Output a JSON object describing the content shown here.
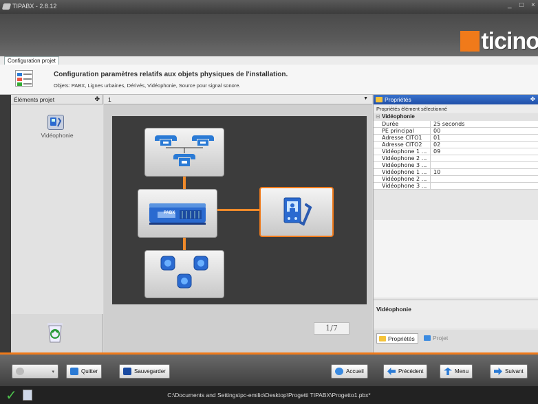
{
  "window": {
    "title": "TIPABX - 2.8.12",
    "minimize": "_",
    "maximize": "□",
    "close": "×"
  },
  "brand": {
    "logo_first": "b",
    "logo_rest": "ticino",
    "accent": "#f07a1a"
  },
  "tab": {
    "label": "Configuration projet"
  },
  "description": {
    "title": "Configuration paramètres relatifs aux objets physiques de l'installation.",
    "subtitle": "Objets: PABX, Lignes urbaines, Dérivés, Vidéophonie, Source pour signal sonore."
  },
  "left_panel": {
    "header": "Éléments projet",
    "pin": "ᵖ",
    "item_label": "Vidéophonie"
  },
  "center": {
    "selector_value": "1",
    "pabx_label": "PABX",
    "page_indicator": "1/7"
  },
  "properties": {
    "header": "Propriétés",
    "subheader": "Propriétés élément sélectionné",
    "category": "Vidéophonie",
    "collapse": "⊟",
    "rows": [
      {
        "key": "Durée",
        "value": "25 seconds"
      },
      {
        "key": "PE principal",
        "value": "00"
      },
      {
        "key": "Adresse CITO1",
        "value": "01"
      },
      {
        "key": "Adresse CITO2",
        "value": "02"
      },
      {
        "key": "Vidéophone 1 ...",
        "value": "09"
      },
      {
        "key": "Vidéophone 2 ...",
        "value": ""
      },
      {
        "key": "Vidéophone 3 ...",
        "value": ""
      },
      {
        "key": "Vidéophone 1 ...",
        "value": "10"
      },
      {
        "key": "Vidéophone 2 ...",
        "value": ""
      },
      {
        "key": "Vidéophone 3 ...",
        "value": ""
      }
    ],
    "description_title": "Vidéophonie",
    "tabs": [
      "Propriétés",
      "Projet"
    ]
  },
  "toolbar": {
    "quit": "Quitter",
    "save": "Sauvegarder",
    "home": "Accueil",
    "previous": "Précédent",
    "menu": "Menu",
    "next": "Suivant"
  },
  "status": {
    "path": "C:\\Documents and Settings\\pc-emilio\\Desktop\\Progetti TIPABX\\Progetto1.pbx*"
  }
}
